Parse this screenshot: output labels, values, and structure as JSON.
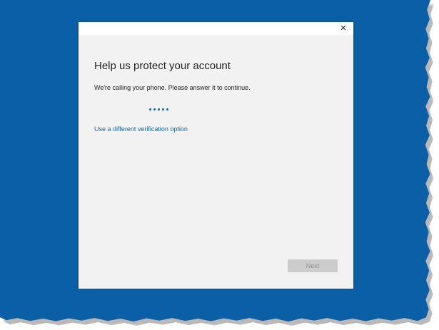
{
  "dialog": {
    "close_glyph": "✕",
    "heading": "Help us protect your account",
    "message": "We're calling your phone. Please answer it to continue.",
    "progress_dots": 5,
    "alt_option_link": "Use a different verification option",
    "next_label": "Next",
    "next_enabled": false
  },
  "colors": {
    "backdrop": "#0a5fa6",
    "dialog_background": "#f2f2f2",
    "accent": "#0067c0",
    "disabled_button": "#cccccc"
  },
  "icons": {
    "close": "close-icon",
    "progress": "progress-dots-icon"
  }
}
